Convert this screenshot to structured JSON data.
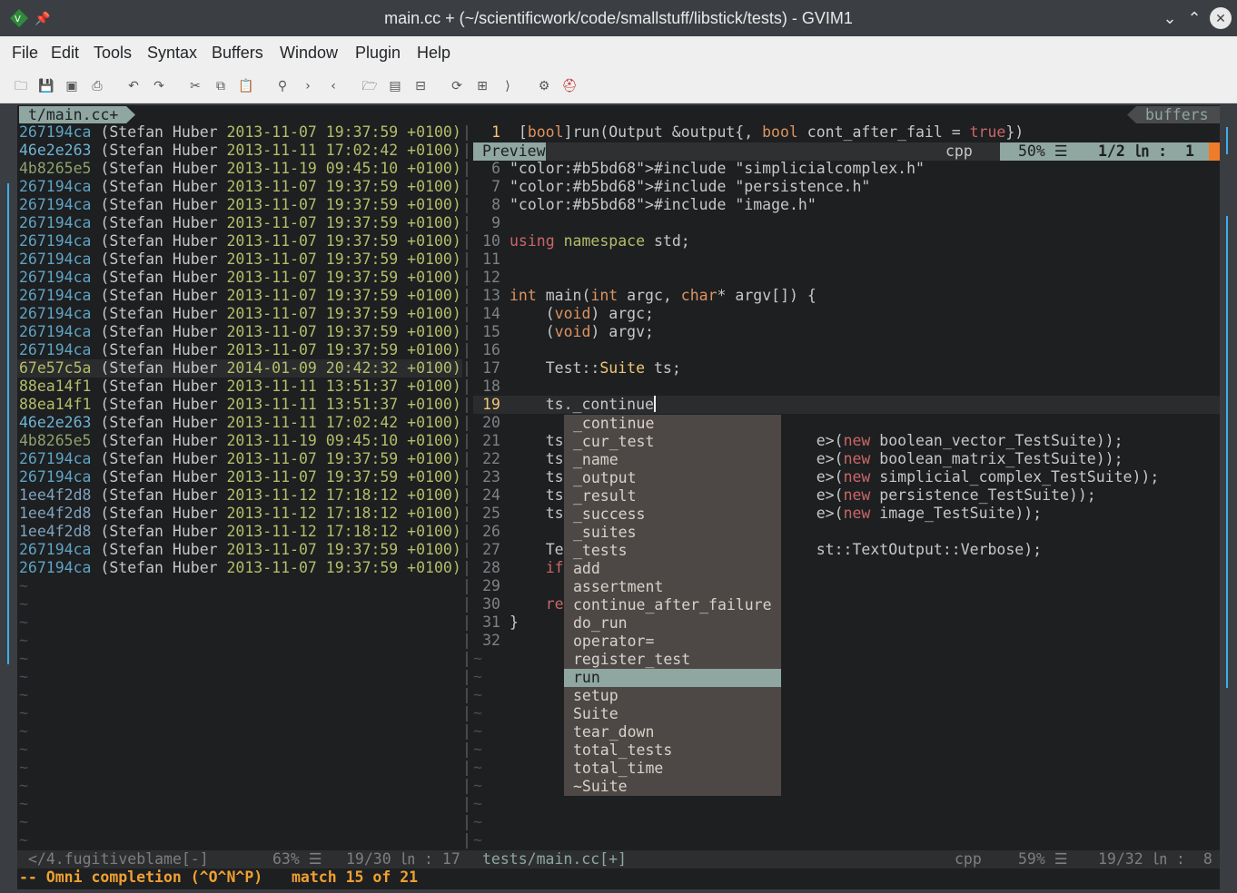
{
  "window": {
    "title": "main.cc + (~/scientificwork/code/smallstuff/libstick/tests) - GVIM1"
  },
  "menu": [
    "File",
    "Edit",
    "Tools",
    "Syntax",
    "Buffers",
    "Window",
    "Plugin",
    "Help"
  ],
  "toolbar_icons": [
    "open-icon",
    "save-icon",
    "save-all-icon",
    "print-icon",
    "undo-icon",
    "redo-icon",
    "cut-icon",
    "copy-icon",
    "paste-icon",
    "find-icon",
    "find-next-icon",
    "find-prev-icon",
    "load-session-icon",
    "save-session-icon",
    "run-script-icon",
    "make-icon",
    "shell-icon",
    "tags-icon",
    "help-icon",
    "find-help-icon"
  ],
  "tabline": {
    "tab": "t/main.cc+",
    "right": "buffers"
  },
  "blame": [
    {
      "hash": "267194ca",
      "author": "(Stefan Huber",
      "date": "2013-11-07 19:37:59",
      "tz": "+0100)",
      "hcolor": "#5fa3c4"
    },
    {
      "hash": "46e2e263",
      "author": "(Stefan Huber",
      "date": "2013-11-11 17:02:42",
      "tz": "+0100)",
      "hcolor": "#6fb3d2"
    },
    {
      "hash": "4b8265e5",
      "author": "(Stefan Huber",
      "date": "2013-11-19 09:45:10",
      "tz": "+0100)",
      "hcolor": "#8ea26a"
    },
    {
      "hash": "267194ca",
      "author": "(Stefan Huber",
      "date": "2013-11-07 19:37:59",
      "tz": "+0100)",
      "hcolor": "#5fa3c4"
    },
    {
      "hash": "267194ca",
      "author": "(Stefan Huber",
      "date": "2013-11-07 19:37:59",
      "tz": "+0100)",
      "hcolor": "#5fa3c4"
    },
    {
      "hash": "267194ca",
      "author": "(Stefan Huber",
      "date": "2013-11-07 19:37:59",
      "tz": "+0100)",
      "hcolor": "#5fa3c4"
    },
    {
      "hash": "267194ca",
      "author": "(Stefan Huber",
      "date": "2013-11-07 19:37:59",
      "tz": "+0100)",
      "hcolor": "#5fa3c4"
    },
    {
      "hash": "267194ca",
      "author": "(Stefan Huber",
      "date": "2013-11-07 19:37:59",
      "tz": "+0100)",
      "hcolor": "#5fa3c4"
    },
    {
      "hash": "267194ca",
      "author": "(Stefan Huber",
      "date": "2013-11-07 19:37:59",
      "tz": "+0100)",
      "hcolor": "#5fa3c4"
    },
    {
      "hash": "267194ca",
      "author": "(Stefan Huber",
      "date": "2013-11-07 19:37:59",
      "tz": "+0100)",
      "hcolor": "#5fa3c4"
    },
    {
      "hash": "267194ca",
      "author": "(Stefan Huber",
      "date": "2013-11-07 19:37:59",
      "tz": "+0100)",
      "hcolor": "#5fa3c4"
    },
    {
      "hash": "267194ca",
      "author": "(Stefan Huber",
      "date": "2013-11-07 19:37:59",
      "tz": "+0100)",
      "hcolor": "#5fa3c4"
    },
    {
      "hash": "267194ca",
      "author": "(Stefan Huber",
      "date": "2013-11-07 19:37:59",
      "tz": "+0100)",
      "hcolor": "#5fa3c4"
    },
    {
      "hash": "67e57c5a",
      "author": "(Stefan Huber",
      "date": "2014-01-09 20:42:32",
      "tz": "+0100)",
      "hcolor": "#b5bd68"
    },
    {
      "hash": "88ea14f1",
      "author": "(Stefan Huber",
      "date": "2013-11-11 13:51:37",
      "tz": "+0100)",
      "hcolor": "#b5bd68"
    },
    {
      "hash": "88ea14f1",
      "author": "(Stefan Huber",
      "date": "2013-11-11 13:51:37",
      "tz": "+0100)",
      "hcolor": "#b5bd68"
    },
    {
      "hash": "46e2e263",
      "author": "(Stefan Huber",
      "date": "2013-11-11 17:02:42",
      "tz": "+0100)",
      "hcolor": "#6fb3d2"
    },
    {
      "hash": "4b8265e5",
      "author": "(Stefan Huber",
      "date": "2013-11-19 09:45:10",
      "tz": "+0100)",
      "hcolor": "#8ea26a"
    },
    {
      "hash": "267194ca",
      "author": "(Stefan Huber",
      "date": "2013-11-07 19:37:59",
      "tz": "+0100)",
      "hcolor": "#5fa3c4"
    },
    {
      "hash": "267194ca",
      "author": "(Stefan Huber",
      "date": "2013-11-07 19:37:59",
      "tz": "+0100)",
      "hcolor": "#5fa3c4"
    },
    {
      "hash": "1ee4f2d8",
      "author": "(Stefan Huber",
      "date": "2013-11-12 17:18:12",
      "tz": "+0100)",
      "hcolor": "#81a2be"
    },
    {
      "hash": "1ee4f2d8",
      "author": "(Stefan Huber",
      "date": "2013-11-12 17:18:12",
      "tz": "+0100)",
      "hcolor": "#81a2be"
    },
    {
      "hash": "1ee4f2d8",
      "author": "(Stefan Huber",
      "date": "2013-11-12 17:18:12",
      "tz": "+0100)",
      "hcolor": "#81a2be"
    },
    {
      "hash": "267194ca",
      "author": "(Stefan Huber",
      "date": "2013-11-07 19:37:59",
      "tz": "+0100)",
      "hcolor": "#5fa3c4"
    },
    {
      "hash": "267194ca",
      "author": "(Stefan Huber",
      "date": "2013-11-07 19:37:59",
      "tz": "+0100)",
      "hcolor": "#5fa3c4"
    }
  ],
  "preview": {
    "ln": "1",
    "text": "[bool]run(Output &output{, bool cont_after_fail = true})"
  },
  "preview_status": {
    "label": "Preview",
    "ft": "cpp",
    "pct": "50% ☰",
    "pos": "1/2 ㏑ :  1"
  },
  "code": [
    {
      "n": "6",
      "t": "#include \"simplicialcomplex.h\""
    },
    {
      "n": "7",
      "t": "#include \"persistence.h\""
    },
    {
      "n": "8",
      "t": "#include \"image.h\""
    },
    {
      "n": "9",
      "t": ""
    },
    {
      "n": "10",
      "t": "using namespace std;"
    },
    {
      "n": "11",
      "t": ""
    },
    {
      "n": "12",
      "t": ""
    },
    {
      "n": "13",
      "t": "int main(int argc, char* argv[]) {"
    },
    {
      "n": "14",
      "t": "    (void) argc;"
    },
    {
      "n": "15",
      "t": "    (void) argv;"
    },
    {
      "n": "16",
      "t": ""
    },
    {
      "n": "17",
      "t": "    Test::Suite ts;"
    },
    {
      "n": "18",
      "t": ""
    },
    {
      "n": "19",
      "t": "    ts._continue"
    },
    {
      "n": "20",
      "t": ""
    },
    {
      "n": "21",
      "t": "    ts                            e>(new boolean_vector_TestSuite));"
    },
    {
      "n": "22",
      "t": "    ts                            e>(new boolean_matrix_TestSuite));"
    },
    {
      "n": "23",
      "t": "    ts                            e>(new simplicial_complex_TestSuite));"
    },
    {
      "n": "24",
      "t": "    ts                            e>(new persistence_TestSuite));"
    },
    {
      "n": "25",
      "t": "    ts                            e>(new image_TestSuite));"
    },
    {
      "n": "26",
      "t": ""
    },
    {
      "n": "27",
      "t": "    Te                            st::TextOutput::Verbose);"
    },
    {
      "n": "28",
      "t": "    if"
    },
    {
      "n": "29",
      "t": ""
    },
    {
      "n": "30",
      "t": "    re"
    },
    {
      "n": "31",
      "t": "}"
    },
    {
      "n": "32",
      "t": ""
    }
  ],
  "popup": [
    "_continue",
    "_cur_test",
    "_name",
    "_output",
    "_result",
    "_success",
    "_suites",
    "_tests",
    "add",
    "assertment",
    "continue_after_failure",
    "do_run",
    "operator=",
    "register_test",
    "run",
    "setup",
    "Suite",
    "tear_down",
    "total_tests",
    "total_time",
    "~Suite"
  ],
  "popup_selected": "run",
  "status_left": {
    "name": "</4.fugitiveblame[-]",
    "pct": "63% ☰",
    "pos": "19/30 ㏑ : 17"
  },
  "status_right": {
    "name": "tests/main.cc[+]",
    "ft": "cpp",
    "pct": "59% ☰",
    "pos": "19/32 ㏑ :  8"
  },
  "cmdline": {
    "mode": "-- Omni completion (^O^N^P)",
    "match": "match 15 of 21"
  },
  "colors": {
    "bg": "#1d1f21",
    "keyword": "#de935f",
    "include": "#b5bd68",
    "new": "#cc6666",
    "accent": "#8fa6a1"
  }
}
